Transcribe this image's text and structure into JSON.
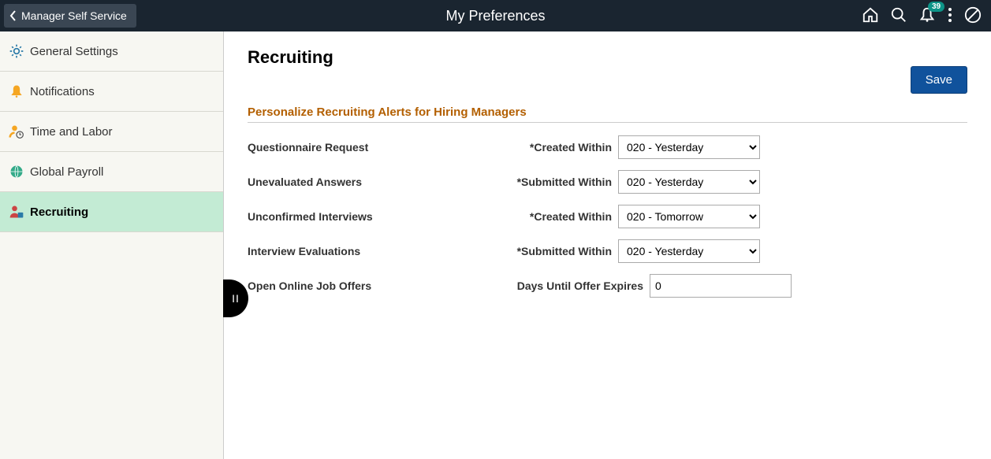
{
  "header": {
    "back_label": "Manager Self Service",
    "title": "My Preferences",
    "notification_count": "39"
  },
  "sidebar": {
    "items": [
      {
        "label": "General Settings"
      },
      {
        "label": "Notifications"
      },
      {
        "label": "Time and Labor"
      },
      {
        "label": "Global Payroll"
      },
      {
        "label": "Recruiting"
      }
    ]
  },
  "main": {
    "page_title": "Recruiting",
    "save_label": "Save",
    "section_title": "Personalize Recruiting Alerts for Hiring Managers",
    "rows": [
      {
        "label": "Questionnaire Request",
        "sublabel": "*Created Within",
        "value": "020 - Yesterday"
      },
      {
        "label": "Unevaluated Answers",
        "sublabel": "*Submitted Within",
        "value": "020 - Yesterday"
      },
      {
        "label": "Unconfirmed Interviews",
        "sublabel": "*Created Within",
        "value": "020 - Tomorrow"
      },
      {
        "label": "Interview Evaluations",
        "sublabel": "*Submitted Within",
        "value": "020 - Yesterday"
      },
      {
        "label": "Open Online Job Offers",
        "sublabel": "Days Until Offer Expires",
        "value": "0",
        "input": true
      }
    ]
  }
}
